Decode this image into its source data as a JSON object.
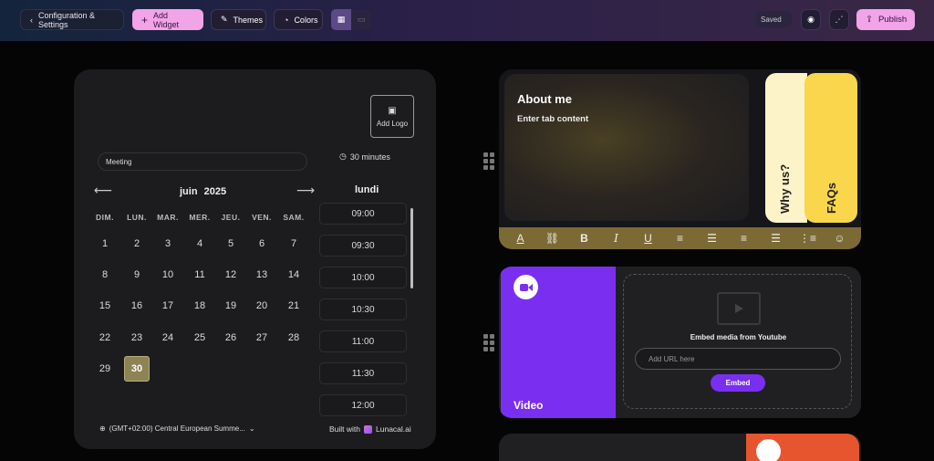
{
  "topbar": {
    "back_label": "Configuration & Settings",
    "add_widget_label": "Add Widget",
    "themes_label": "Themes",
    "colors_label": "Colors",
    "saved_label": "Saved",
    "publish_label": "Publish"
  },
  "calendar": {
    "add_logo_label": "Add Logo",
    "meeting_value": "Meeting",
    "duration": "30 minutes",
    "month": "juin",
    "year": "2025",
    "weekday": "lundi",
    "days_of_week": [
      "DIM.",
      "LUN.",
      "MAR.",
      "MER.",
      "JEU.",
      "VEN.",
      "SAM."
    ],
    "weeks": [
      [
        "1",
        "2",
        "3",
        "4",
        "5",
        "6",
        "7"
      ],
      [
        "8",
        "9",
        "10",
        "11",
        "12",
        "13",
        "14"
      ],
      [
        "15",
        "16",
        "17",
        "18",
        "19",
        "20",
        "21"
      ],
      [
        "22",
        "23",
        "24",
        "25",
        "26",
        "27",
        "28"
      ],
      [
        "29",
        "30",
        "",
        "",
        "",
        "",
        ""
      ]
    ],
    "selected_day": "30",
    "time_slots": [
      "09:00",
      "09:30",
      "10:00",
      "10:30",
      "11:00",
      "11:30",
      "12:00"
    ],
    "timezone": "(GMT+02:00) Central European Summe...",
    "built_with": "Built with",
    "brand": "Lunacal.ai"
  },
  "about": {
    "title": "About me",
    "body": "Enter tab content",
    "tabs": [
      "Why us?",
      "FAQs"
    ]
  },
  "video": {
    "label": "Video",
    "embed_text": "Embed media from Youtube",
    "url_placeholder": "Add URL here",
    "embed_button": "Embed"
  },
  "colors": {
    "accent_pink": "#f1a4e8",
    "video_purple": "#7a2ff0",
    "faq_yellow": "#f9d64b",
    "toolbar_olive": "#7b6a34",
    "selected_day": "#8d8356"
  }
}
